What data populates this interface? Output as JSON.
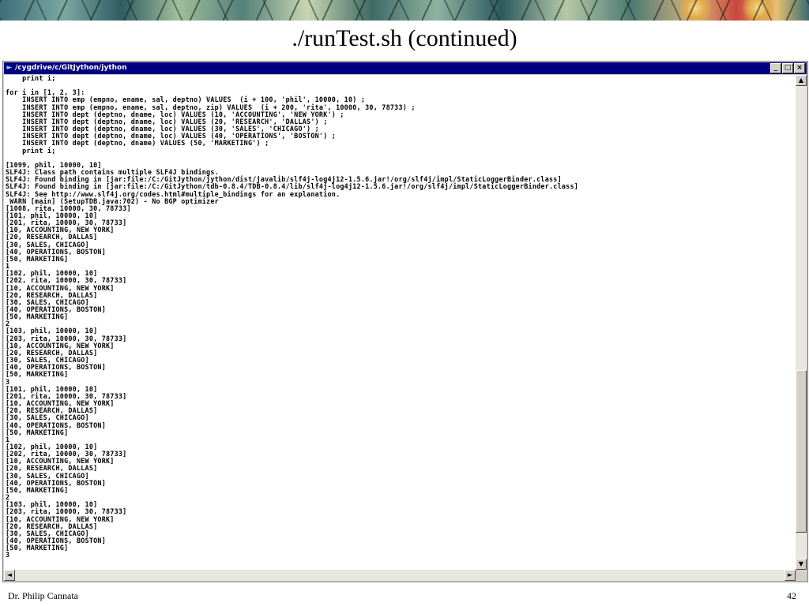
{
  "slide": {
    "title": "./runTest.sh (continued)",
    "author": "Dr. Philip Cannata",
    "page_number": "42"
  },
  "window": {
    "title": "/cygdrive/c/GitJython/jython",
    "system_icon": "console-icon",
    "buttons": {
      "minimize": "_",
      "maximize": "□",
      "close": "×"
    }
  },
  "scrollbars": {
    "up": "▲",
    "down": "▼",
    "left": "◄",
    "right": "►"
  },
  "console": {
    "lines": [
      "    print i;",
      "",
      "for i in [1, 2, 3]:",
      "    INSERT INTO emp (empno, ename, sal, deptno) VALUES  (i + 100, 'phil', 10000, 10) ;",
      "    INSERT INTO emp (empno, ename, sal, deptno, zip) VALUES  (i + 200, 'rita', 10000, 30, 78733) ;",
      "    INSERT INTO dept (deptno, dname, loc) VALUES (10, 'ACCOUNTING', 'NEW YORK') ;",
      "    INSERT INTO dept (deptno, dname, loc) VALUES (20, 'RESEARCH', 'DALLAS') ;",
      "    INSERT INTO dept (deptno, dname, loc) VALUES (30, 'SALES', 'CHICAGO') ;",
      "    INSERT INTO dept (deptno, dname, loc) VALUES (40, 'OPERATIONS', 'BOSTON') ;",
      "    INSERT INTO dept (deptno, dname) VALUES (50, 'MARKETING') ;",
      "    print i;",
      "",
      "[1099, phil, 10000, 10]",
      "SLF4J: Class path contains multiple SLF4J bindings.",
      "SLF4J: Found binding in [jar:file:/C:/GitJython/jython/dist/javalib/slf4j-log4j12-1.5.6.jar!/org/slf4j/impl/StaticLoggerBinder.class]",
      "SLF4J: Found binding in [jar:file:/C:/GitJython/tdb-0.8.4/TDB-0.8.4/lib/slf4j-log4j12-1.5.6.jar!/org/slf4j/impl/StaticLoggerBinder.class]",
      "SLF4J: See http://www.slf4j.org/codes.html#multiple_bindings for an explanation.",
      " WARN [main] (SetupTDB.java:702) - No BGP optimizer",
      "[1008, rita, 10000, 30, 78733]",
      "[101, phil, 10000, 10]",
      "[201, rita, 10000, 30, 78733]",
      "[10, ACCOUNTING, NEW YORK]",
      "[20, RESEARCH, DALLAS]",
      "[30, SALES, CHICAGO]",
      "[40, OPERATIONS, BOSTON]",
      "[50, MARKETING]",
      "1",
      "[102, phil, 10000, 10]",
      "[202, rita, 10000, 30, 78733]",
      "[10, ACCOUNTING, NEW YORK]",
      "[20, RESEARCH, DALLAS]",
      "[30, SALES, CHICAGO]",
      "[40, OPERATIONS, BOSTON]",
      "[50, MARKETING]",
      "2",
      "[103, phil, 10000, 10]",
      "[203, rita, 10000, 30, 78733]",
      "[10, ACCOUNTING, NEW YORK]",
      "[20, RESEARCH, DALLAS]",
      "[30, SALES, CHICAGO]",
      "[40, OPERATIONS, BOSTON]",
      "[50, MARKETING]",
      "3",
      "[101, phil, 10000, 10]",
      "[201, rita, 10000, 30, 78733]",
      "[10, ACCOUNTING, NEW YORK]",
      "[20, RESEARCH, DALLAS]",
      "[30, SALES, CHICAGO]",
      "[40, OPERATIONS, BOSTON]",
      "[50, MARKETING]",
      "1",
      "[102, phil, 10000, 10]",
      "[202, rita, 10000, 30, 78733]",
      "[10, ACCOUNTING, NEW YORK]",
      "[20, RESEARCH, DALLAS]",
      "[30, SALES, CHICAGO]",
      "[40, OPERATIONS, BOSTON]",
      "[50, MARKETING]",
      "2",
      "[103, phil, 10000, 10]",
      "[203, rita, 10000, 30, 78733]",
      "[10, ACCOUNTING, NEW YORK]",
      "[20, RESEARCH, DALLAS]",
      "[30, SALES, CHICAGO]",
      "[40, OPERATIONS, BOSTON]",
      "[50, MARKETING]",
      "3"
    ]
  },
  "colors": {
    "titlebar": "#000080",
    "window_chrome": "#d4d0c8",
    "console_bg": "#ffffff",
    "console_text": "#000000"
  }
}
